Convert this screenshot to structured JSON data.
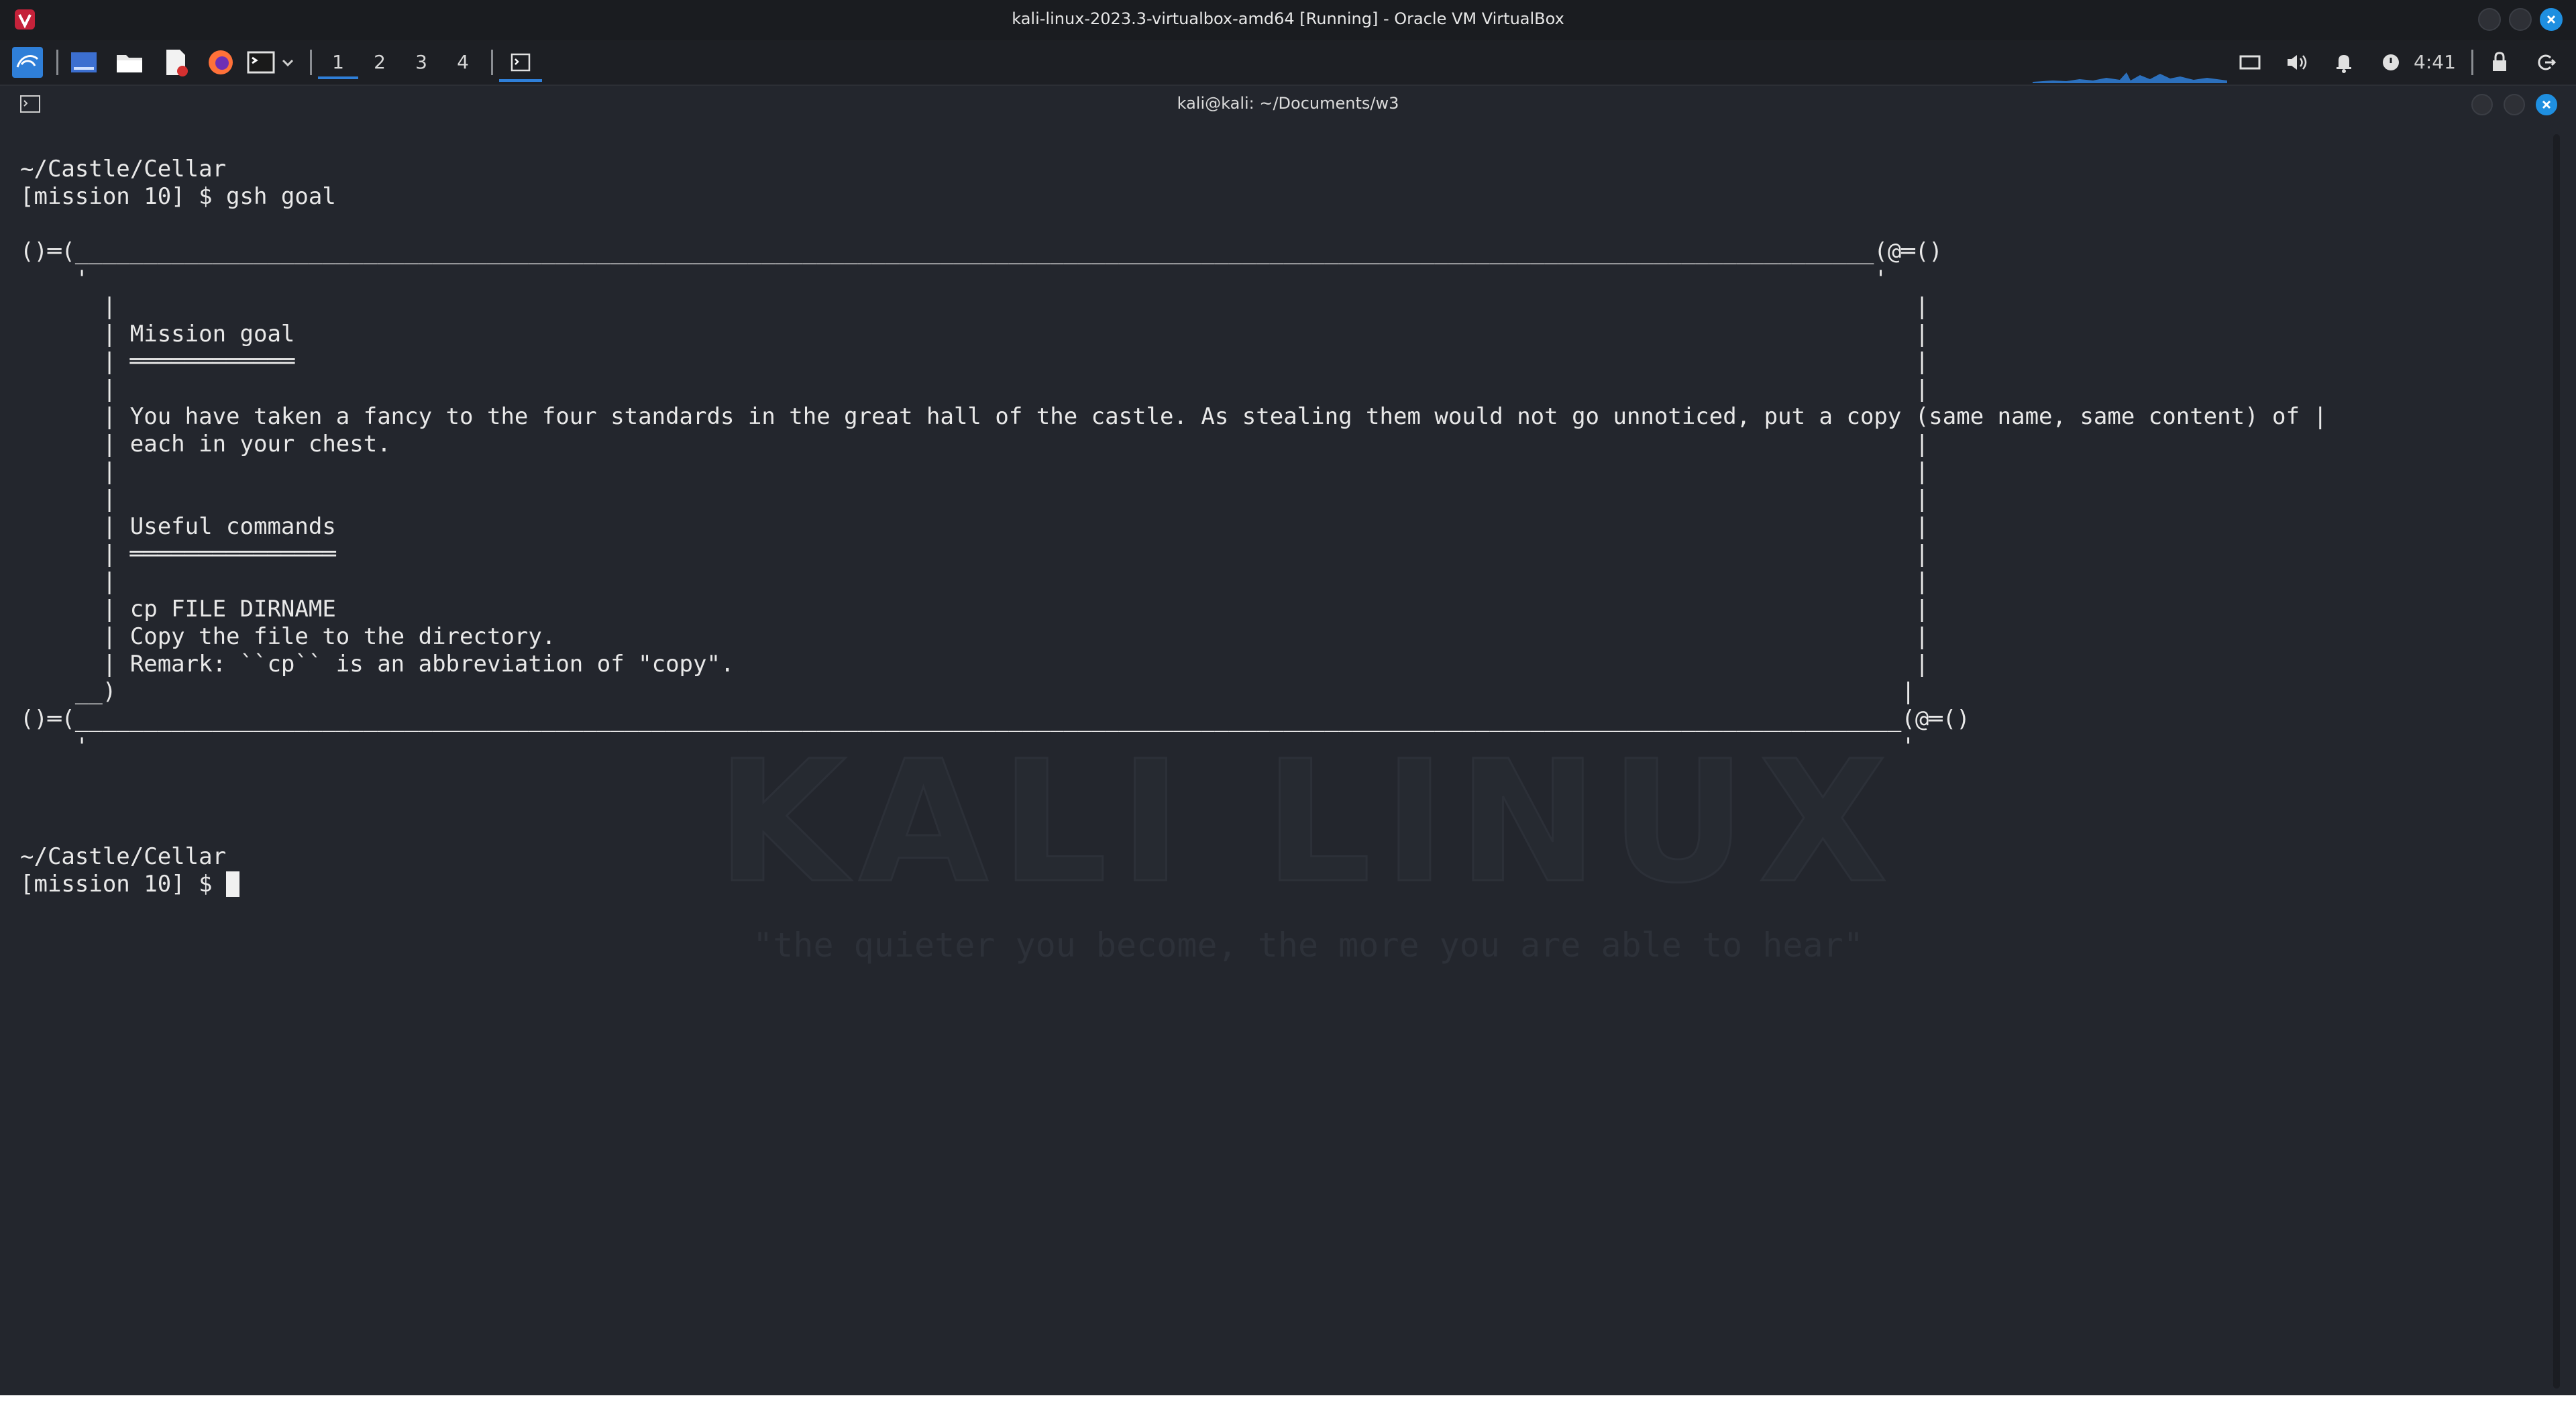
{
  "vbox": {
    "title": "kali-linux-2023.3-virtualbox-amd64 [Running] - Oracle VM VirtualBox"
  },
  "panel": {
    "workspaces": [
      "1",
      "2",
      "3",
      "4"
    ],
    "active_workspace": "1",
    "clock": "4:41",
    "icons": [
      "kali-menu-icon",
      "show-desktop-icon",
      "file-manager-icon",
      "text-editor-icon",
      "firefox-icon",
      "terminal-icon",
      "terminal-dropdown-icon",
      "terminal-window-icon",
      "cpu-graph",
      "display-icon",
      "volume-icon",
      "notifications-icon",
      "power-icon",
      "lock-icon",
      "logout-icon"
    ]
  },
  "terminal": {
    "window_title": "kali@kali: ~/Documents/w3",
    "lines": [
      "~/Castle/Cellar",
      "[mission 10] $ gsh goal",
      "",
      "()═(___________________________________________________________________________________________________________________________________(@═()",
      "    '                                                                                                                                  '",
      "      |                                                                                                                                   |",
      "      | Mission goal                                                                                                                      |",
      "      | ════════════                                                                                                                      |",
      "      |                                                                                                                                   |",
      "      | You have taken a fancy to the four standards in the great hall of the castle. As stealing them would not go unnoticed, put a copy (same name, same content) of |",
      "      | each in your chest.                                                                                                               |",
      "      |                                                                                                                                   |",
      "      |                                                                                                                                   |",
      "      | Useful commands                                                                                                                   |",
      "      | ═══════════════                                                                                                                   |",
      "      |                                                                                                                                   |",
      "      | cp FILE DIRNAME                                                                                                                   |",
      "      | Copy the file to the directory.                                                                                                   |",
      "      | Remark: ``cp`` is an abbreviation of \"copy\".                                                                                      |",
      "    __)                                                                                                                                  |",
      "()═(_____________________________________________________________________________________________________________________________________(@═()",
      "    '                                                                                                                                    '",
      "",
      "",
      "~/Castle/Cellar",
      "[mission 10] $ "
    ]
  },
  "wallpaper": {
    "brand": "KALI LINUX",
    "tagline": "\"the quieter you become, the more you are able to hear\""
  },
  "colors": {
    "terminal_bg": "#23262d",
    "terminal_fg": "#e8e8e8",
    "accent": "#2f7fd8"
  }
}
